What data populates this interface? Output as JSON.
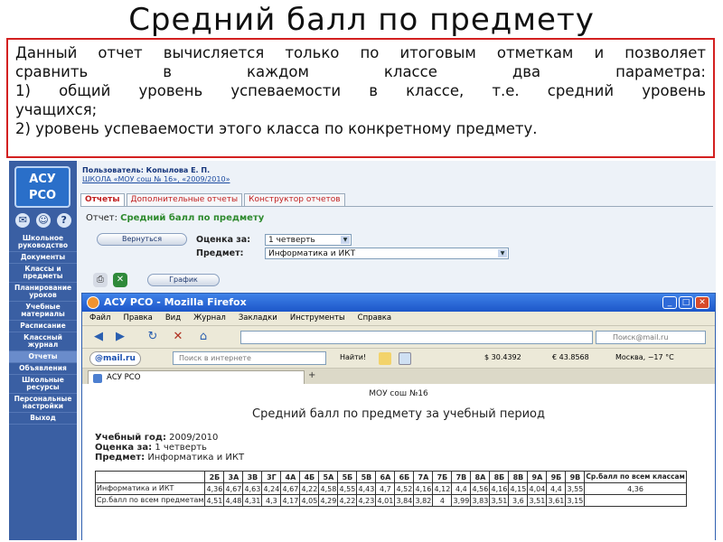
{
  "slide": {
    "title": "Средний балл по предмету",
    "description_lines": [
      "Данный отчет вычисляется только по итоговым отметкам и позволяет",
      "сравнить в каждом классе два параметра:",
      "1) общий уровень успеваемости в классе, т.е. средний уровень",
      "учащихся;",
      "2) уровень успеваемости этого класса по конкретному предмету."
    ]
  },
  "app": {
    "logo_top": "АСУ",
    "logo_bottom": "РСО",
    "user_line": "Пользователь: Копылова Е. П.",
    "school_line": "ШКОЛА «МОУ сош № 16», «2009/2010»",
    "sidebar_items": [
      "Школьное руководство",
      "Документы",
      "Классы и предметы",
      "Планирование уроков",
      "Учебные материалы",
      "Расписание",
      "Классный журнал",
      "Отчеты",
      "Объявления",
      "Школьные ресурсы",
      "Персональные настройки",
      "Выход"
    ],
    "tabs": [
      "Отчеты",
      "Дополнительные отчеты",
      "Конструктор отчетов"
    ],
    "report_label": "Отчет:",
    "report_name": "Средний балл по предмету",
    "back_button": "Вернуться",
    "period_label": "Оценка за:",
    "period_value": "1 четверть",
    "subject_label": "Предмет:",
    "subject_value": "Информатика и ИКТ",
    "graph_button": "График"
  },
  "browser": {
    "window_title": "АСУ РСО - Mozilla Firefox",
    "menu": [
      "Файл",
      "Правка",
      "Вид",
      "Журнал",
      "Закладки",
      "Инструменты",
      "Справка"
    ],
    "search_placeholder": "Поиск@mail.ru",
    "mail_logo": "@mail.ru",
    "mail_search_placeholder": "Поиск в интернете",
    "find_button": "Найти!",
    "usd": "$ 30.4392",
    "eur": "€ 43.8568",
    "weather": "Москва, −17 °C",
    "tab_title": "АСУ РСО"
  },
  "report": {
    "school": "МОУ сош №16",
    "heading": "Средний балл по предмету за учебный период",
    "year_label": "Учебный год:",
    "year": "2009/2010",
    "period_label": "Оценка за:",
    "period": "1 четверть",
    "subject_label": "Предмет:",
    "subject": "Информатика и ИКТ",
    "columns": [
      "2Б",
      "3А",
      "3В",
      "3Г",
      "4А",
      "4Б",
      "5А",
      "5Б",
      "5В",
      "6А",
      "6Б",
      "7А",
      "7Б",
      "7В",
      "8А",
      "8Б",
      "8В",
      "9А",
      "9Б",
      "9В"
    ],
    "total_column": "Ср.балл по всем классам",
    "rows": [
      {
        "name": "Информатика и ИКТ",
        "values": [
          "4,36",
          "4,67",
          "4,63",
          "4,24",
          "4,67",
          "4,22",
          "4,58",
          "4,55",
          "4,43",
          "4,7",
          "4,52",
          "4,16",
          "4,12",
          "4,4",
          "4,56",
          "4,16",
          "4,15",
          "4,04",
          "4,4",
          "3,55"
        ],
        "total": "4,36"
      },
      {
        "name": "Ср.балл по всем предметам",
        "values": [
          "4,51",
          "4,48",
          "4,31",
          "4,3",
          "4,17",
          "4,05",
          "4,29",
          "4,22",
          "4,23",
          "4,01",
          "3,84",
          "3,82",
          "4",
          "3,99",
          "3,83",
          "3,51",
          "3,6",
          "3,51",
          "3,61",
          "3,15"
        ],
        "total": ""
      }
    ]
  }
}
